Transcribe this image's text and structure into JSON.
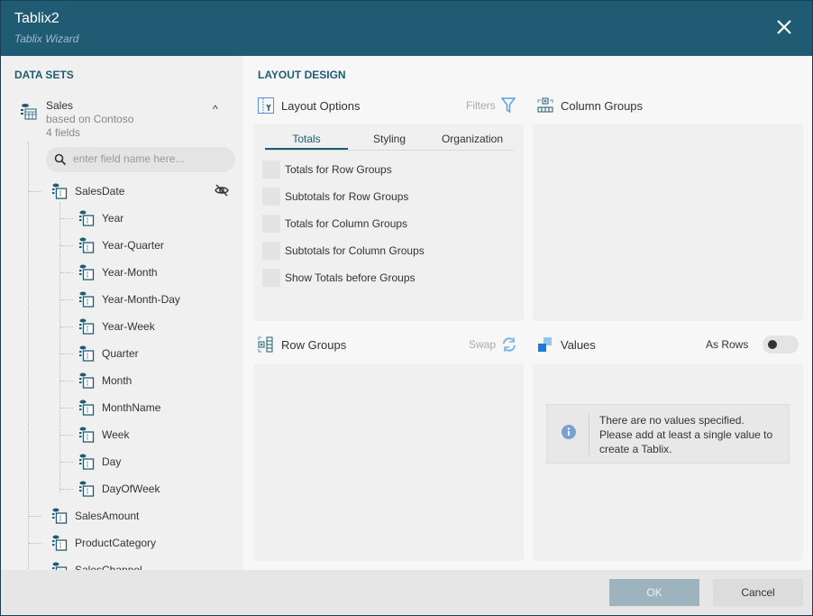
{
  "header": {
    "title": "Tablix2",
    "subtitle": "Tablix Wizard",
    "close_icon": "close-icon"
  },
  "datasets": {
    "heading": "DATA SETS",
    "dataset": {
      "name": "Sales",
      "source": "based on Contoso",
      "count": "4 fields"
    },
    "search_placeholder": "enter field name here...",
    "fields": [
      {
        "label": "SalesDate",
        "level": 0,
        "hidden_toggle": true
      },
      {
        "label": "Year",
        "level": 1
      },
      {
        "label": "Year-Quarter",
        "level": 1
      },
      {
        "label": "Year-Month",
        "level": 1
      },
      {
        "label": "Year-Month-Day",
        "level": 1
      },
      {
        "label": "Year-Week",
        "level": 1
      },
      {
        "label": "Quarter",
        "level": 1
      },
      {
        "label": "Month",
        "level": 1
      },
      {
        "label": "MonthName",
        "level": 1
      },
      {
        "label": "Week",
        "level": 1
      },
      {
        "label": "Day",
        "level": 1
      },
      {
        "label": "DayOfWeek",
        "level": 1
      },
      {
        "label": "SalesAmount",
        "level": 0
      },
      {
        "label": "ProductCategory",
        "level": 0
      },
      {
        "label": "SalesChannel",
        "level": 0
      }
    ]
  },
  "layout": {
    "heading": "LAYOUT DESIGN",
    "layout_options": {
      "title": "Layout Options",
      "filters": "Filters",
      "tabs": [
        "Totals",
        "Styling",
        "Organization"
      ],
      "active_tab": "Totals",
      "options": [
        "Totals for Row Groups",
        "Subtotals for Row Groups",
        "Totals for Column Groups",
        "Subtotals for Column Groups",
        "Show Totals before Groups"
      ]
    },
    "column_groups": {
      "title": "Column Groups"
    },
    "row_groups": {
      "title": "Row Groups",
      "swap": "Swap"
    },
    "values": {
      "title": "Values",
      "as_rows": "As Rows",
      "as_rows_on": false,
      "message": [
        "There are no values specified.",
        "Please add at least a single value to",
        "create a Tablix."
      ]
    }
  },
  "footer": {
    "ok": "OK",
    "cancel": "Cancel"
  },
  "colors": {
    "header": "#1f5c74",
    "accent": "#1f5c74",
    "icon_blue": "#5a9bd8"
  }
}
